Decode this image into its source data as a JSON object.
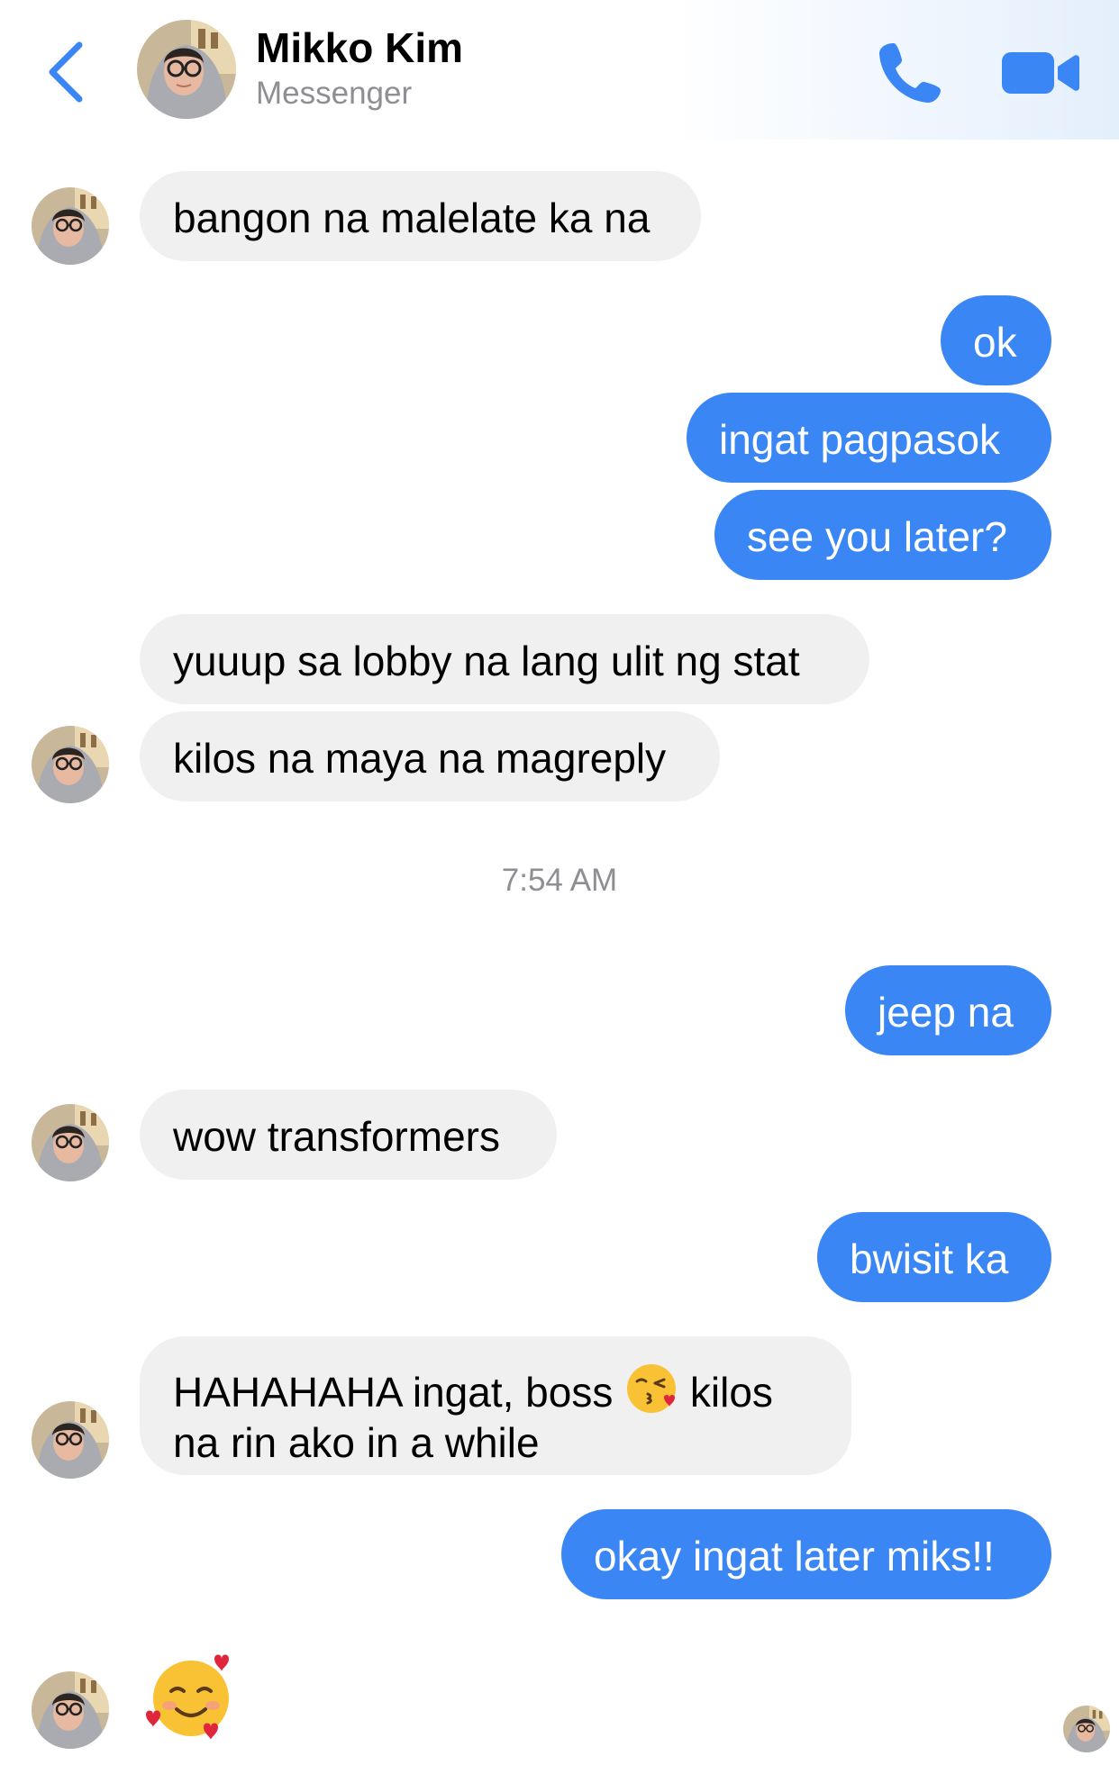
{
  "header": {
    "contact_name": "Mikko Kim",
    "subtitle": "Messenger",
    "back_icon": "chevron-left-icon",
    "call_icon": "phone-icon",
    "video_icon": "video-camera-icon",
    "accent_color": "#3a86f5"
  },
  "messages": [
    {
      "from": "contact",
      "text": "bangon na malelate ka na"
    },
    {
      "from": "me",
      "text": "ok"
    },
    {
      "from": "me",
      "text": "ingat pagpasok"
    },
    {
      "from": "me",
      "text": "see you later?"
    },
    {
      "from": "contact",
      "text": "yuuup sa lobby na lang ulit ng stat"
    },
    {
      "from": "contact",
      "text": "kilos na maya na magreply"
    },
    {
      "from": "me",
      "text": "jeep na"
    },
    {
      "from": "contact",
      "text": "wow transformers"
    },
    {
      "from": "me",
      "text": "bwisit ka"
    },
    {
      "from": "contact",
      "text_before": "HAHAHAHA ingat, boss",
      "emoji": "face-blowing-kiss",
      "text_after": "kilos na rin ako in a while"
    },
    {
      "from": "me",
      "text": "okay ingat later miks!!"
    },
    {
      "from": "contact",
      "emoji": "smiling-face-with-hearts"
    }
  ],
  "timestamp": "7:54 AM",
  "seen_indicator": "contact-avatar"
}
